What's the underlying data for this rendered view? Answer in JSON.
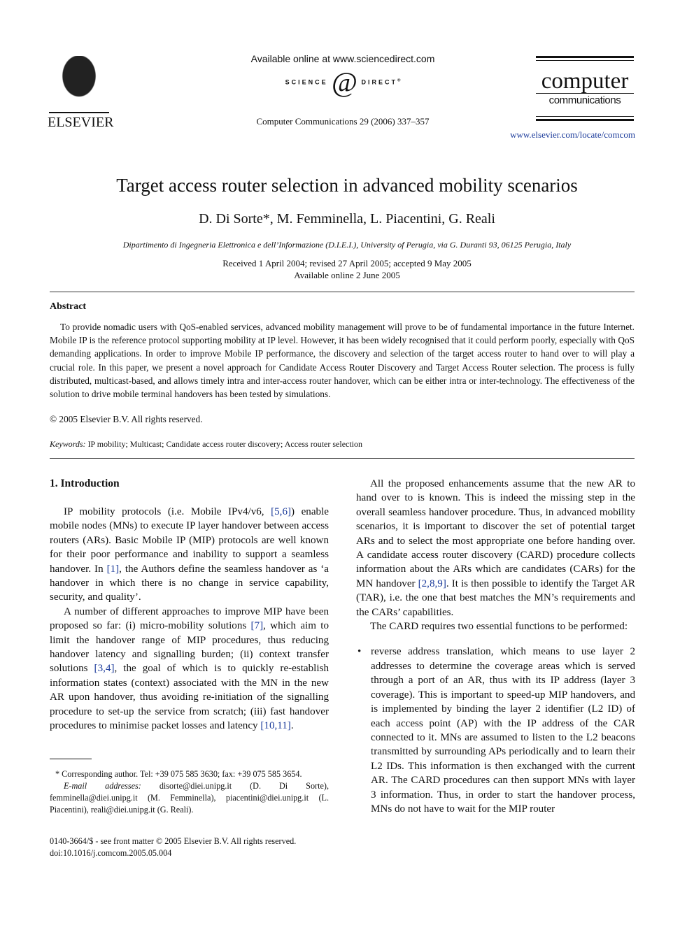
{
  "header": {
    "publisher_logo": {
      "icon": "elsevier-tree-icon",
      "wordmark": "ELSEVIER"
    },
    "available_online": "Available online at www.sciencedirect.com",
    "sciencedirect_logo": {
      "left": "SCIENCE",
      "at": "@",
      "right": "DIRECT",
      "tm": "®"
    },
    "journal_ref": "Computer Communications 29 (2006) 337–357",
    "journal_logo": {
      "line1": "computer",
      "line2": "communications"
    },
    "journal_url": "www.elsevier.com/locate/comcom"
  },
  "article": {
    "title": "Target access router selection in advanced mobility scenarios",
    "authors": "D. Di Sorte*, M. Femminella, L. Piacentini, G. Reali",
    "affiliation": "Dipartimento di Ingegneria Elettronica e dell’Informazione (D.I.E.I.), University of Perugia, via G. Duranti 93, 06125 Perugia, Italy",
    "received": "Received 1 April 2004; revised 27 April 2005; accepted 9 May 2005",
    "available": "Available online 2 June 2005"
  },
  "abstract": {
    "heading": "Abstract",
    "body": "To provide nomadic users with QoS-enabled services, advanced mobility management will prove to be of fundamental importance in the future Internet. Mobile IP is the reference protocol supporting mobility at IP level. However, it has been widely recognised that it could perform poorly, especially with QoS demanding applications. In order to improve Mobile IP performance, the discovery and selection of the target access router to hand over to will play a crucial role. In this paper, we present a novel approach for Candidate Access Router Discovery and Target Access Router selection. The process is fully distributed, multicast-based, and allows timely intra and inter-access router handover, which can be either intra or inter-technology. The effectiveness of the solution to drive mobile terminal handovers has been tested by simulations.",
    "copyright": "© 2005 Elsevier B.V. All rights reserved.",
    "keywords_label": "Keywords:",
    "keywords": "IP mobility; Multicast; Candidate access router discovery; Access router selection"
  },
  "intro": {
    "heading": "1. Introduction",
    "p1": {
      "a": "IP mobility protocols (i.e. Mobile IPv4/v6, ",
      "ref1": "[5,6]",
      "b": ") enable mobile nodes (MNs) to execute IP layer handover between access routers (ARs). Basic Mobile IP (MIP) protocols are well known for their poor performance and inability to support a seamless handover. In ",
      "ref2": "[1]",
      "c": ", the Authors define the seamless handover as ‘a handover in which there is no change in service capability, security, and quality’."
    },
    "p2": {
      "a": "A number of different approaches to improve MIP have been proposed so far: (i) micro-mobility solutions ",
      "ref1": "[7]",
      "b": ", which aim to limit the handover range of MIP procedures, thus reducing handover latency and signalling burden; (ii) context transfer solutions ",
      "ref2": "[3,4]",
      "c": ", the goal of which is to quickly re-establish information states (context) associated with the MN in the new AR upon handover, thus avoiding re-initiation of the signalling procedure to set-up the service from scratch; (iii) fast handover procedures to minimise packet losses and latency ",
      "ref3": "[10,11]",
      "d": "."
    },
    "p3": {
      "a": "All the proposed enhancements assume that the new AR to hand over to is known. This is indeed the missing step in the overall seamless handover procedure. Thus, in advanced mobility scenarios, it is important to discover the set of potential target ARs and to select the most appropriate one before handing over. A candidate access router discovery (CARD) procedure collects information about the ARs which are candidates (CARs) for the MN handover ",
      "ref1": "[2,8,9]",
      "b": ". It is then possible to identify the Target AR (TAR), i.e. the one that best matches the MN’s requirements and the CARs’ capabilities."
    },
    "p4": "The CARD requires two essential functions to be performed:",
    "bullets": [
      "reverse address translation, which means to use layer 2 addresses to determine the coverage areas which is served through a port of an AR, thus with its IP address (layer 3 coverage). This is important to speed-up MIP handovers, and is implemented by binding the layer 2 identifier (L2 ID) of each access point (AP) with the IP address of the CAR connected to it. MNs are assumed to listen to the L2 beacons transmitted by surrounding APs periodically and to learn their L2 IDs. This information is then exchanged with the current AR. The CARD procedures can then support MNs with layer 3 information. Thus, in order to start the handover process, MNs do not have to wait for the MIP router"
    ],
    "bullet_glyph": "•"
  },
  "footnotes": {
    "corresponding": "* Corresponding author. Tel: +39 075 585 3630; fax: +39 075 585 3654.",
    "email_label": "E-mail addresses:",
    "emails": "disorte@diei.unipg.it (D. Di Sorte), femminella@diei.unipg.it (M. Femminella), piacentini@diei.unipg.it (L. Piacentini), reali@diei.unipg.it (G. Reali).",
    "issn": "0140-3664/$ - see front matter © 2005 Elsevier B.V. All rights reserved.",
    "doi": "doi:10.1016/j.comcom.2005.05.004"
  }
}
